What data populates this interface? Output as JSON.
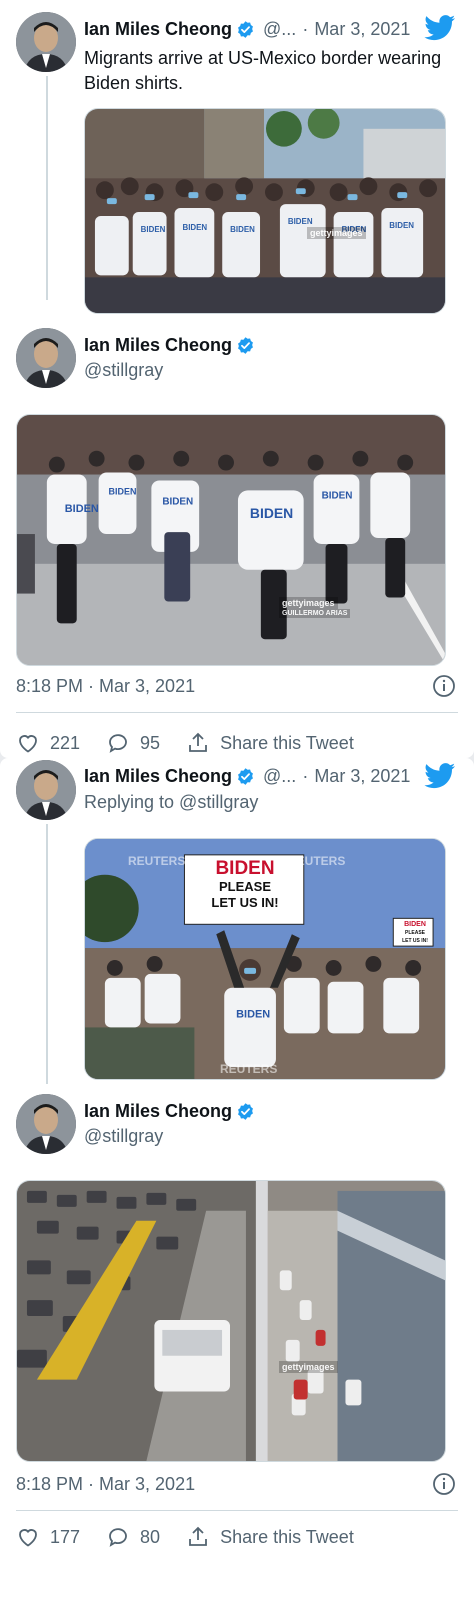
{
  "colors": {
    "verified": "#1d9bf0",
    "twitter_blue": "#1d9bf0",
    "muted": "#536471",
    "border": "#cfd9de"
  },
  "tweet1": {
    "name": "Ian Miles Cheong",
    "handle_short": "@...",
    "date": "Mar 3, 2021",
    "text": "Migrants arrive at US-Mexico border wearing Biden shirts.",
    "watermark": "gettyimages"
  },
  "tweet1_main": {
    "name": "Ian Miles Cheong",
    "handle": "@stillgray",
    "watermark": "gettyimages",
    "watermark_credit": "GUILLERMO ARIAS",
    "timestamp": "8:18 PM · Mar 3, 2021",
    "likes": "221",
    "replies": "95",
    "share_label": "Share this Tweet"
  },
  "tweet2": {
    "name": "Ian Miles Cheong",
    "handle_short": "@...",
    "date": "Mar 3, 2021",
    "replying": "Replying to @stillgray",
    "sign_main": [
      "BIDEN",
      "PLEASE",
      "LET US IN!"
    ],
    "sign_small": [
      "BIDEN",
      "PLEASE",
      "LET US IN!"
    ],
    "watermark": "REUTERS"
  },
  "tweet2_main": {
    "name": "Ian Miles Cheong",
    "handle": "@stillgray",
    "watermark": "gettyimages",
    "timestamp": "8:18 PM · Mar 3, 2021",
    "likes": "177",
    "replies": "80",
    "share_label": "Share this Tweet"
  },
  "icons": [
    "verified-badge-icon",
    "twitter-bird-icon",
    "info-icon",
    "heart-icon",
    "reply-icon",
    "share-icon"
  ]
}
